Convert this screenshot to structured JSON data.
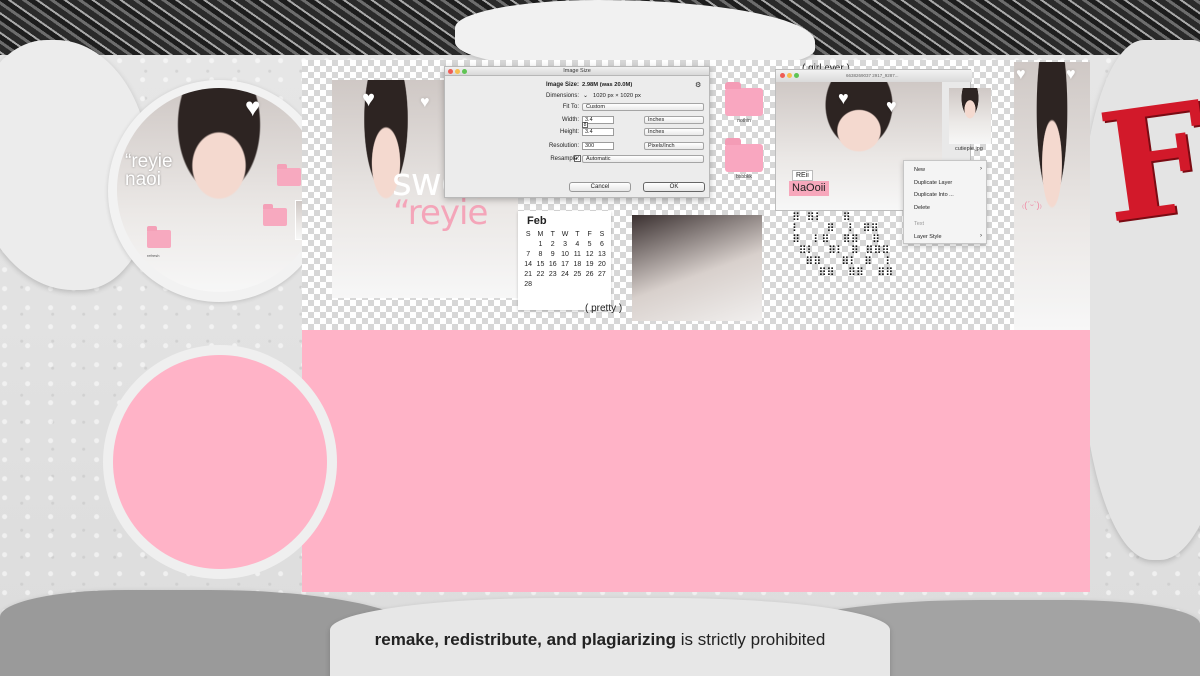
{
  "avatar": {
    "name_line1": "“reyie",
    "name_line2": "naoi",
    "folder_caption": "refresh"
  },
  "banner": {
    "sticker_sweet": "sweet",
    "sticker_reyie": "“reyie",
    "image_size_dialog": {
      "title": "Image Size",
      "image_size_label": "Image Size:",
      "image_size_value": "2.98M (was 20.0M)",
      "dimensions_label": "Dimensions:",
      "dimensions_value": "1020 px  ×  1020 px",
      "fit_to_label": "Fit To:",
      "fit_to_value": "Custom",
      "width_label": "Width:",
      "width_value": "3.4",
      "width_unit": "Inches",
      "height_label": "Height:",
      "height_value": "3.4",
      "height_unit": "Inches",
      "resolution_label": "Resolution:",
      "resolution_value": "300",
      "resolution_unit": "Pixels/Inch",
      "resample_label": "Resample:",
      "resample_value": "Automatic",
      "cancel_label": "Cancel",
      "ok_label": "OK"
    },
    "folders": [
      {
        "label": "nothin"
      },
      {
        "label": "bsbbkk"
      }
    ],
    "calendar": {
      "month": "Feb",
      "weekdays": [
        "S",
        "M",
        "T",
        "W",
        "T",
        "F",
        "S"
      ],
      "days": [
        "",
        "1",
        "2",
        "3",
        "4",
        "5",
        "6",
        "7",
        "8",
        "9",
        "10",
        "11",
        "12",
        "13",
        "14",
        "15",
        "16",
        "17",
        "18",
        "19",
        "20",
        "21",
        "22",
        "23",
        "24",
        "25",
        "26",
        "27",
        "28",
        "",
        "",
        "",
        "",
        "",
        ""
      ]
    },
    "pretty_label": "( pretty )",
    "girl_ever_label": "( girl ever )",
    "mac_window_title": "6638269037 2917_9287...",
    "tag_reii": "REii",
    "tag_naooii": "NaOoii",
    "photo_caption": "cutiepie.jpg",
    "kaomoji": "₍(ˊᵕˋ)₎",
    "context_menu": {
      "items": [
        "New",
        "Duplicate Layer",
        "Duplicate Into ...",
        "Delete",
        "Text",
        "Layer Style"
      ]
    }
  },
  "footer": {
    "bold_text": "remake, redistribute, and plagiarizing",
    "normal_text": "is strictly prohibited"
  },
  "colors": {
    "pink": "#ffb3c7",
    "folder_pink": "#f9a7c0",
    "red_accent": "#d2192a"
  }
}
